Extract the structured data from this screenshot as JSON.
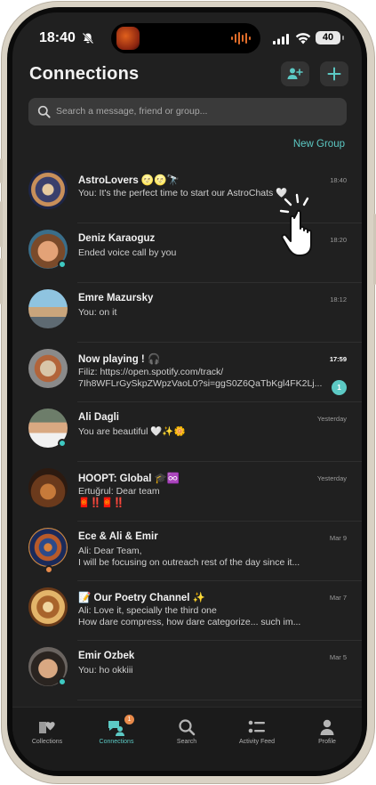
{
  "status_bar": {
    "time": "18:40",
    "battery": "40"
  },
  "header": {
    "title": "Connections"
  },
  "search": {
    "placeholder": "Search a message, friend or group..."
  },
  "new_group_label": "New Group",
  "chats": [
    {
      "name": "AstroLovers 🌝🌝🔭",
      "message": "You: It's the perfect time to start our AstroChats 🤍",
      "time": "18:40",
      "online": false
    },
    {
      "name": "Deniz Karaoguz",
      "message": "Ended voice call by you",
      "time": "18:20",
      "online": true
    },
    {
      "name": "Emre Mazursky",
      "message": "You: on it",
      "time": "18:12",
      "online": false
    },
    {
      "name": "Now playing ! 🎧",
      "message": "Filiz: https://open.spotify.com/track/",
      "message2": "7Ih8WFLrGySkpZWpzVaoL0?si=ggS0Z6QaTbKgl4FK2Lj...",
      "time": "17:59",
      "unread": "1",
      "online": false
    },
    {
      "name": "Ali Dagli",
      "message": "You are beautiful 🤍✨🌼",
      "time": "Yesterday",
      "online": true
    },
    {
      "name": "HOOPT: Global 🎓♾️",
      "message": "Ertuğrul: Dear team",
      "message2": "🧧‼️🧧‼️",
      "time": "Yesterday",
      "online": false
    },
    {
      "name": "Ece & Ali & Emir",
      "message": "Ali: Dear Team,",
      "message2": "I will be focusing on outreach rest of the day since it...",
      "time": "Mar 9",
      "online": false
    },
    {
      "name": "📝 Our Poetry Channel ✨",
      "message": "Ali: Love it, specially the third one",
      "message2": "How dare compress, how dare categorize... such im...",
      "time": "Mar 7",
      "online": false
    },
    {
      "name": "Emir Ozbek",
      "message": "You: ho okkiii",
      "time": "Mar 5",
      "online": true
    }
  ],
  "nav": [
    {
      "label": "Collections",
      "icon": "heart-book-icon"
    },
    {
      "label": "Connections",
      "icon": "chat-people-icon",
      "badge": "1"
    },
    {
      "label": "Search",
      "icon": "search-icon"
    },
    {
      "label": "Activity Feed",
      "icon": "feed-list-icon"
    },
    {
      "label": "Profile",
      "icon": "person-icon"
    }
  ],
  "colors": {
    "accent": "#5cc9c4",
    "background": "#202020",
    "badge": "#e88a4a"
  }
}
